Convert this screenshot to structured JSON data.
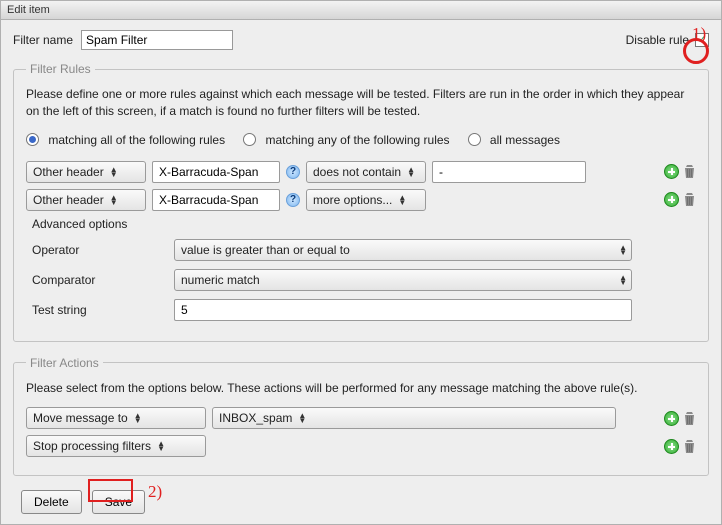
{
  "window": {
    "title": "Edit item"
  },
  "top": {
    "filter_name_label": "Filter name",
    "filter_name_value": "Spam Filter",
    "disable_rule_label": "Disable rule",
    "disable_rule_checked": true
  },
  "rules": {
    "legend": "Filter Rules",
    "description": "Please define one or more rules against which each message will be tested. Filters are run in the order in which they appear on the left of this screen, if a match is found no further filters will be tested.",
    "match_modes": {
      "all": "matching all of the following rules",
      "any": "matching any of the following rules",
      "all_msgs": "all messages",
      "selected": "all"
    },
    "rows": [
      {
        "field": "Other header",
        "header_value": "X-Barracuda-Span",
        "operator": "does not contain",
        "value": "-"
      },
      {
        "field": "Other header",
        "header_value": "X-Barracuda-Span",
        "operator": "more options..."
      }
    ],
    "advanced": {
      "heading": "Advanced options",
      "operator_label": "Operator",
      "operator_value": "value is greater than or equal to",
      "comparator_label": "Comparator",
      "comparator_value": "numeric match",
      "test_label": "Test string",
      "test_value": "5"
    }
  },
  "actions": {
    "legend": "Filter Actions",
    "description": "Please select from the options below. These actions will be performed for any message matching the above rule(s).",
    "rows": [
      {
        "action": "Move message to",
        "target": "INBOX_spam"
      },
      {
        "action": "Stop processing filters"
      }
    ]
  },
  "buttons": {
    "delete": "Delete",
    "save": "Save"
  },
  "annotations": {
    "one": "1)",
    "two": "2)"
  }
}
